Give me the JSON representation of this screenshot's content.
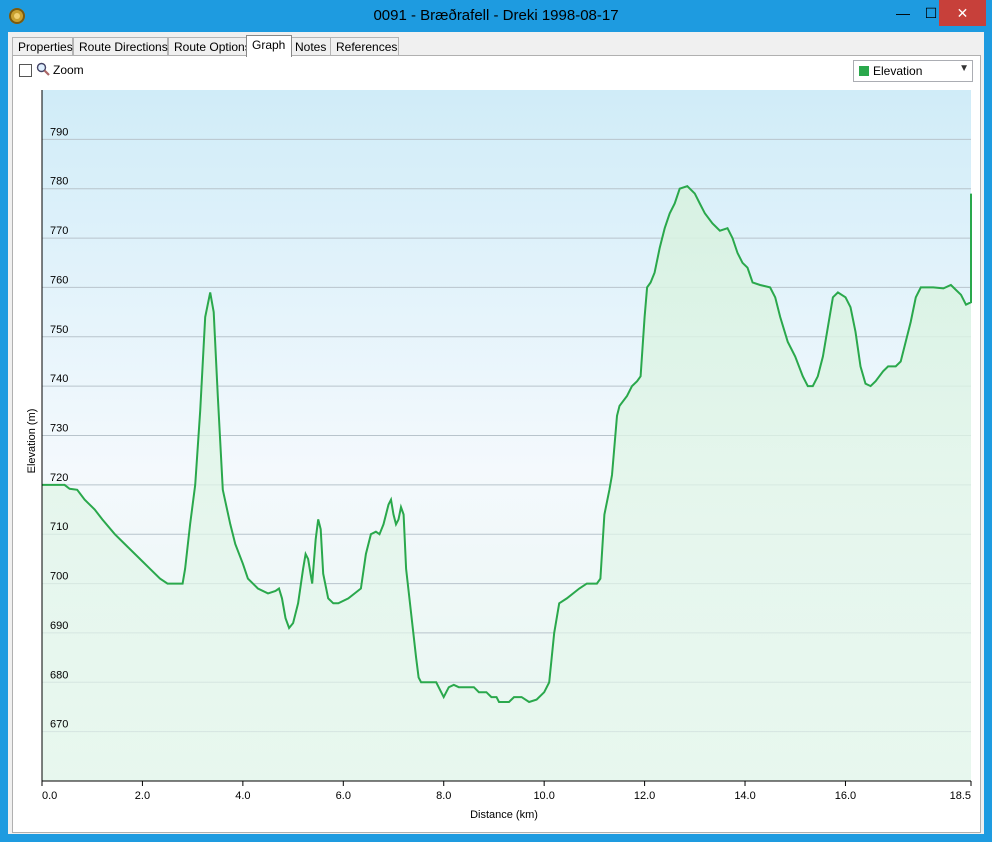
{
  "window": {
    "title": "0091 - Bræðrafell - Dreki 1998-08-17",
    "controls": {
      "minimize": "—",
      "maximize": "☐",
      "close": "✕"
    }
  },
  "tabs": [
    {
      "label": "Properties"
    },
    {
      "label": "Route Directions"
    },
    {
      "label": "Route Options"
    },
    {
      "label": "Graph",
      "active": true
    },
    {
      "label": "Notes"
    },
    {
      "label": "References"
    }
  ],
  "toolbar": {
    "zoom_label": "Zoom",
    "zoom_checked": false,
    "series_select": {
      "selected": "Elevation",
      "swatch_color": "#2aa84c"
    }
  },
  "chart_data": {
    "type": "area",
    "xlabel": "Distance  (km)",
    "ylabel": "Elevation (m)",
    "xlim": [
      0,
      18.5
    ],
    "ylim": [
      660,
      800
    ],
    "x_ticks": [
      0,
      2,
      4,
      6,
      8,
      10,
      12,
      14,
      16,
      18.5
    ],
    "x_tick_labels": [
      "0.0",
      "2.0",
      "4.0",
      "6.0",
      "8.0",
      "10.0",
      "12.0",
      "14.0",
      "16.0",
      "18.5"
    ],
    "y_ticks": [
      670,
      680,
      690,
      700,
      710,
      720,
      730,
      740,
      750,
      760,
      770,
      780,
      790
    ],
    "y_tick_labels": [
      "670",
      "680",
      "690",
      "700",
      "710",
      "720",
      "730",
      "740",
      "750",
      "760",
      "770",
      "780",
      "790"
    ],
    "grid": "horizontal",
    "series_color": "#2aa84c",
    "series": [
      {
        "name": "Elevation",
        "points": [
          [
            0.0,
            720
          ],
          [
            0.45,
            720
          ],
          [
            0.55,
            719.2
          ],
          [
            0.7,
            719
          ],
          [
            0.85,
            717
          ],
          [
            1.05,
            715
          ],
          [
            1.2,
            713
          ],
          [
            1.45,
            710
          ],
          [
            1.7,
            707.5
          ],
          [
            1.95,
            705
          ],
          [
            2.15,
            703
          ],
          [
            2.35,
            701
          ],
          [
            2.5,
            700
          ],
          [
            2.75,
            700
          ],
          [
            2.8,
            700
          ],
          [
            2.85,
            703
          ],
          [
            2.95,
            712
          ],
          [
            3.05,
            720
          ],
          [
            3.15,
            735
          ],
          [
            3.25,
            754
          ],
          [
            3.35,
            759
          ],
          [
            3.42,
            755
          ],
          [
            3.5,
            738
          ],
          [
            3.6,
            719
          ],
          [
            3.75,
            712
          ],
          [
            3.85,
            708
          ],
          [
            4.0,
            704
          ],
          [
            4.1,
            701
          ],
          [
            4.3,
            699
          ],
          [
            4.5,
            698
          ],
          [
            4.65,
            698.5
          ],
          [
            4.72,
            699
          ],
          [
            4.78,
            697
          ],
          [
            4.85,
            693
          ],
          [
            4.92,
            691
          ],
          [
            5.0,
            692
          ],
          [
            5.1,
            696
          ],
          [
            5.2,
            703
          ],
          [
            5.25,
            706
          ],
          [
            5.3,
            705
          ],
          [
            5.38,
            700
          ],
          [
            5.45,
            709
          ],
          [
            5.5,
            713
          ],
          [
            5.55,
            711
          ],
          [
            5.6,
            702
          ],
          [
            5.7,
            697
          ],
          [
            5.8,
            696
          ],
          [
            5.9,
            696
          ],
          [
            6.1,
            697
          ],
          [
            6.35,
            699
          ],
          [
            6.45,
            706
          ],
          [
            6.55,
            710
          ],
          [
            6.65,
            710.5
          ],
          [
            6.72,
            710
          ],
          [
            6.8,
            712
          ],
          [
            6.9,
            716
          ],
          [
            6.95,
            717
          ],
          [
            7.0,
            714
          ],
          [
            7.05,
            712
          ],
          [
            7.1,
            713
          ],
          [
            7.15,
            715.5
          ],
          [
            7.2,
            714
          ],
          [
            7.25,
            703
          ],
          [
            7.35,
            694
          ],
          [
            7.45,
            685
          ],
          [
            7.5,
            681
          ],
          [
            7.55,
            680
          ],
          [
            7.85,
            680
          ],
          [
            7.95,
            678
          ],
          [
            8.0,
            677
          ],
          [
            8.1,
            679
          ],
          [
            8.2,
            679.5
          ],
          [
            8.3,
            679
          ],
          [
            8.6,
            679
          ],
          [
            8.7,
            678
          ],
          [
            8.85,
            678
          ],
          [
            8.95,
            677
          ],
          [
            9.05,
            677
          ],
          [
            9.1,
            676
          ],
          [
            9.3,
            676
          ],
          [
            9.4,
            677
          ],
          [
            9.55,
            677
          ],
          [
            9.7,
            676
          ],
          [
            9.85,
            676.5
          ],
          [
            10.0,
            678
          ],
          [
            10.1,
            680
          ],
          [
            10.15,
            685
          ],
          [
            10.2,
            690
          ],
          [
            10.3,
            696
          ],
          [
            10.45,
            697
          ],
          [
            10.7,
            699
          ],
          [
            10.85,
            700
          ],
          [
            10.95,
            700
          ],
          [
            11.05,
            700
          ],
          [
            11.12,
            701
          ],
          [
            11.2,
            714
          ],
          [
            11.3,
            719
          ],
          [
            11.35,
            722
          ],
          [
            11.45,
            734
          ],
          [
            11.5,
            736
          ],
          [
            11.65,
            738
          ],
          [
            11.75,
            740
          ],
          [
            11.85,
            741
          ],
          [
            11.92,
            742
          ],
          [
            12.0,
            754
          ],
          [
            12.05,
            760
          ],
          [
            12.12,
            761
          ],
          [
            12.2,
            763
          ],
          [
            12.3,
            768
          ],
          [
            12.4,
            772
          ],
          [
            12.5,
            775
          ],
          [
            12.6,
            777
          ],
          [
            12.7,
            780
          ],
          [
            12.85,
            780.5
          ],
          [
            13.0,
            779
          ],
          [
            13.1,
            777
          ],
          [
            13.2,
            775
          ],
          [
            13.35,
            773
          ],
          [
            13.5,
            771.5
          ],
          [
            13.65,
            772
          ],
          [
            13.75,
            770
          ],
          [
            13.85,
            767
          ],
          [
            13.95,
            765
          ],
          [
            14.05,
            764
          ],
          [
            14.15,
            761
          ],
          [
            14.3,
            760.5
          ],
          [
            14.5,
            760
          ],
          [
            14.6,
            758
          ],
          [
            14.7,
            754
          ],
          [
            14.85,
            749
          ],
          [
            15.0,
            746
          ],
          [
            15.15,
            742
          ],
          [
            15.25,
            740
          ],
          [
            15.35,
            740
          ],
          [
            15.45,
            742
          ],
          [
            15.55,
            746
          ],
          [
            15.65,
            752
          ],
          [
            15.75,
            758
          ],
          [
            15.85,
            759
          ],
          [
            16.0,
            758
          ],
          [
            16.1,
            756
          ],
          [
            16.2,
            751
          ],
          [
            16.3,
            744
          ],
          [
            16.4,
            740.5
          ],
          [
            16.5,
            740
          ],
          [
            16.6,
            741
          ],
          [
            16.75,
            743
          ],
          [
            16.85,
            744
          ],
          [
            17.0,
            744
          ],
          [
            17.1,
            745
          ],
          [
            17.2,
            749
          ],
          [
            17.3,
            753
          ],
          [
            17.4,
            758
          ],
          [
            17.5,
            760
          ],
          [
            17.75,
            760
          ],
          [
            17.95,
            759.8
          ],
          [
            18.1,
            760.5
          ],
          [
            18.2,
            759.5
          ],
          [
            18.3,
            758.5
          ],
          [
            18.4,
            756.5
          ],
          [
            18.5,
            757
          ],
          [
            18.6,
            758
          ],
          [
            18.7,
            760
          ],
          [
            18.8,
            762
          ],
          [
            18.9,
            767
          ],
          [
            19.0,
            772
          ],
          [
            19.05,
            779
          ]
        ]
      }
    ]
  }
}
